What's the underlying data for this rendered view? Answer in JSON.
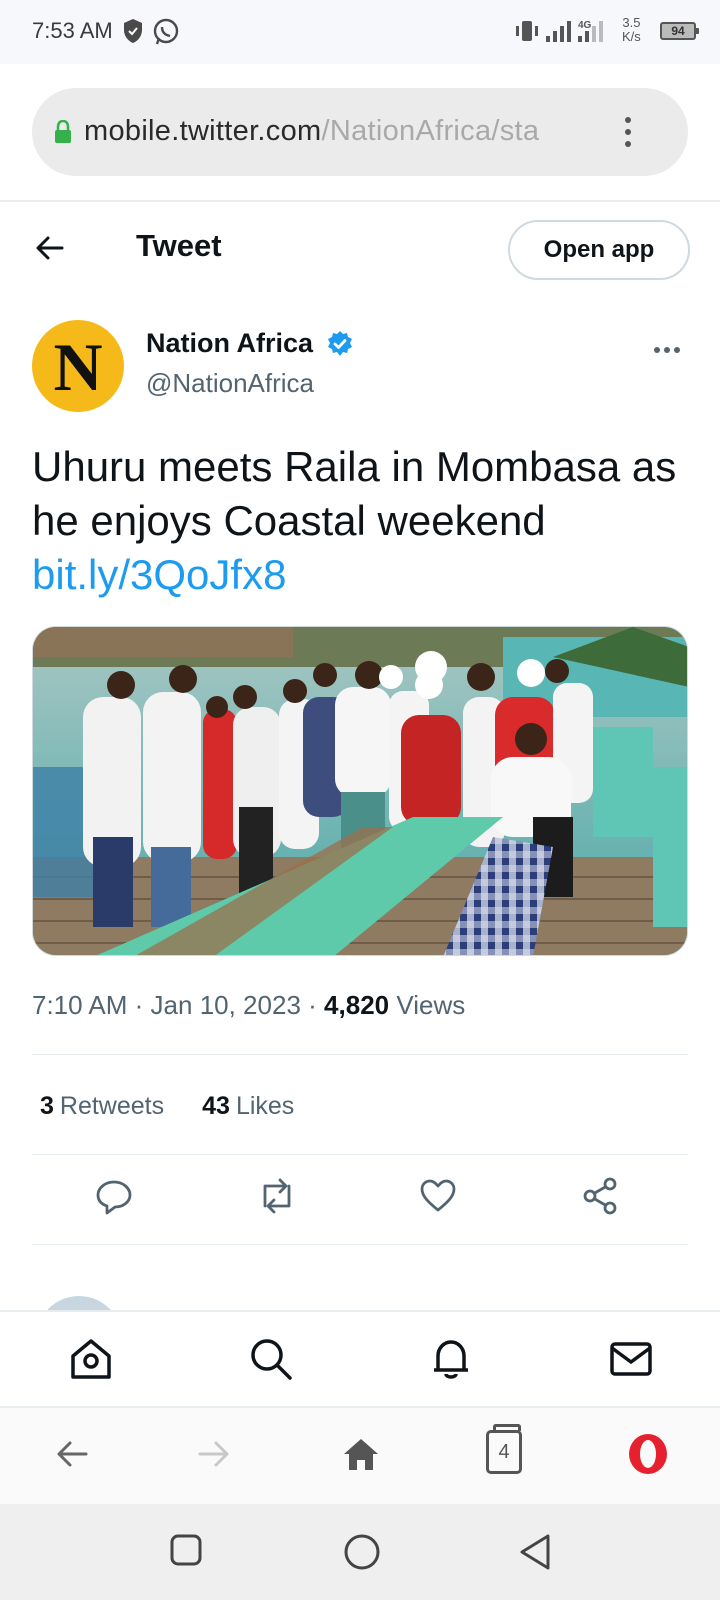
{
  "status_bar": {
    "time": "7:53 AM",
    "speed_value": "3.5",
    "speed_unit": "K/s",
    "battery": "94",
    "network": "4G"
  },
  "browser": {
    "url_host": "mobile.twitter.com",
    "url_path": "/NationAfrica/sta"
  },
  "header": {
    "title": "Tweet",
    "open_app_label": "Open app"
  },
  "tweet": {
    "author_name": "Nation Africa",
    "author_handle": "@NationAfrica",
    "avatar_letter": "N",
    "text": "Uhuru meets Raila in Mombasa as he enjoys Coastal weekend",
    "link": "bit.ly/3QoJfx8",
    "time": "7:10 AM",
    "date": "Jan 10, 2023",
    "views_count": "4,820",
    "views_label": "Views",
    "separator": "·",
    "retweets_count": "3",
    "retweets_label": "Retweets",
    "likes_count": "43",
    "likes_label": "Likes"
  },
  "opera": {
    "tab_count": "4"
  },
  "colors": {
    "accent": "#1d9bf0",
    "avatar_bg": "#f5b919",
    "opera_red": "#e5212f",
    "secondary_text": "#536471"
  },
  "icons": {
    "status": [
      "shield-icon",
      "whatsapp-icon",
      "vibrate-icon",
      "signal-icon",
      "battery-icon"
    ],
    "actions": [
      "reply-icon",
      "retweet-icon",
      "like-icon",
      "share-icon"
    ],
    "twitter_nav": [
      "home-icon",
      "search-icon",
      "notifications-icon",
      "messages-icon"
    ],
    "opera_nav": [
      "back-icon",
      "forward-icon",
      "home-icon",
      "tabs-icon",
      "opera-icon"
    ],
    "android_nav": [
      "recents-icon",
      "home-icon",
      "back-icon"
    ]
  }
}
